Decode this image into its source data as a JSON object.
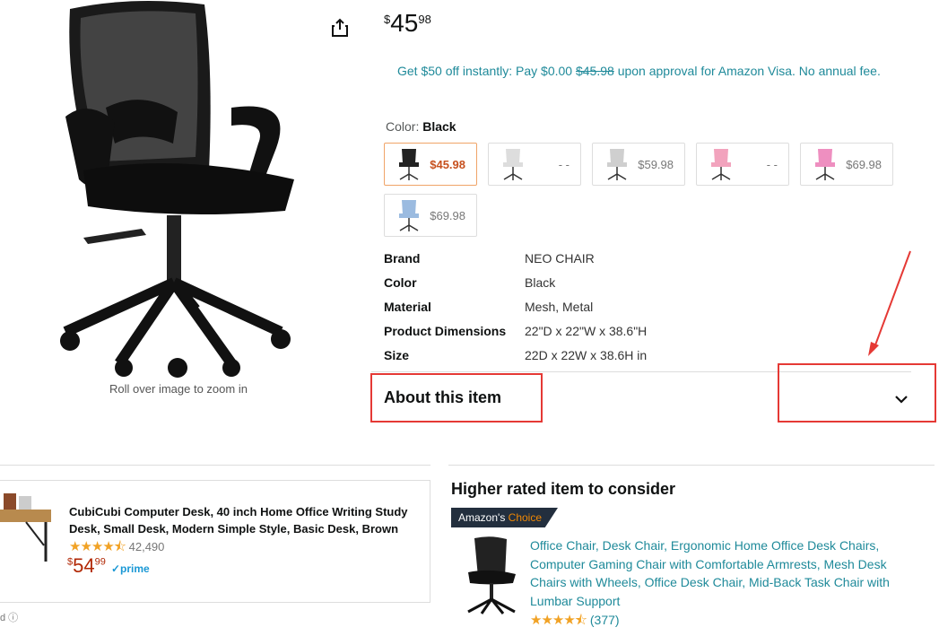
{
  "product": {
    "image_caption": "Roll over image to zoom in",
    "price_symbol": "$",
    "price_whole": "45",
    "price_fraction": "98",
    "promo": {
      "before": "Get $50 off instantly: Pay $0.00 ",
      "struck": "$45.98",
      "after": " upon approval for Amazon Visa. No annual fee."
    },
    "color_label": "Color: ",
    "color_value": "Black",
    "swatches": [
      {
        "color": "#222222",
        "price": "$45.98",
        "selected": true
      },
      {
        "color": "#dddddd",
        "price": "- -"
      },
      {
        "color": "#cfcfcf",
        "price": "$59.98"
      },
      {
        "color": "#f2a3bd",
        "price": "- -"
      },
      {
        "color": "#ee8fc0",
        "price": "$69.98"
      },
      {
        "color": "#9bbbe0",
        "price": "$69.98"
      }
    ],
    "specs": [
      {
        "k": "Brand",
        "v": "NEO CHAIR"
      },
      {
        "k": "Color",
        "v": "Black"
      },
      {
        "k": "Material",
        "v": "Mesh, Metal"
      },
      {
        "k": "Product Dimensions",
        "v": "22\"D x 22\"W x 38.6\"H"
      },
      {
        "k": "Size",
        "v": "22D x 22W x 38.6H in"
      }
    ],
    "about_label": "About this item"
  },
  "sponsored": {
    "title": "CubiCubi Computer Desk, 40 inch Home Office Writing Study Desk, Small Desk, Modern Simple Style, Basic Desk, Brown",
    "stars": "★★★★⯪",
    "rating_count": "42,490",
    "price_symbol": "$",
    "price_whole": "54",
    "price_fraction": "99",
    "prime": "✓prime",
    "footer": "d ⓘ"
  },
  "higher_rated": {
    "heading": "Higher rated item to consider",
    "badge_a": "Amazon's ",
    "badge_b": "Choice",
    "title": "Office Chair, Desk Chair, Ergonomic Home Office Desk Chairs, Computer Gaming Chair with Comfortable Armrests, Mesh Desk Chairs with Wheels, Office Desk Chair, Mid-Back Task Chair with Lumbar Support",
    "stars": "★★★★⯪",
    "rating_count": "(377)"
  },
  "colors": {
    "link": "#1f8a9a",
    "price_red": "#b12704",
    "annotation": "#e53935",
    "star": "#f1a225"
  }
}
